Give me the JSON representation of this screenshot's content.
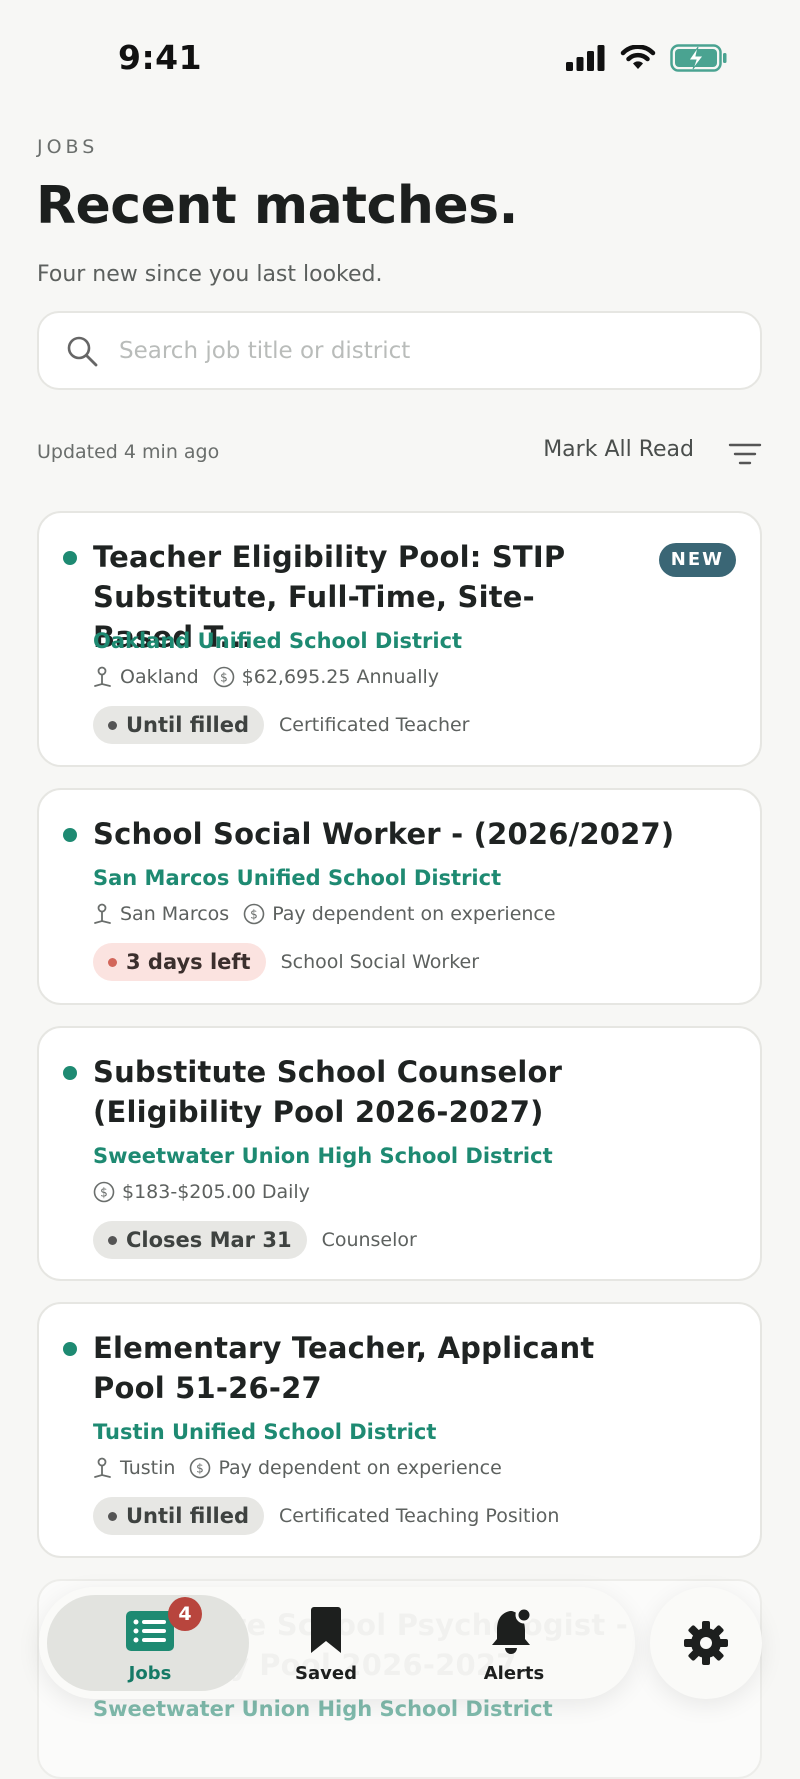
{
  "status": {
    "time": "9:41"
  },
  "header": {
    "eyebrow": "JOBS",
    "title": "Recent matches.",
    "subtitle": "Four new since you last looked."
  },
  "search": {
    "placeholder": "Search job title or district",
    "value": ""
  },
  "meta": {
    "updated": "Updated 4 min ago",
    "mark_all": "Mark All Read"
  },
  "jobs": [
    {
      "title": "Teacher Eligibility Pool: STIP Substitute, Full-Time, Site-Based T...",
      "badge": "NEW",
      "district": "Oakland Unified School District",
      "location": "Oakland",
      "salary": "$62,695.25 Annually",
      "deadline": "Until filled",
      "category": "Certificated Teacher"
    },
    {
      "title": "School Social Worker - (2026/2027)",
      "district": "San Marcos Unified School District",
      "location": "San Marcos",
      "salary": "Pay dependent on experience",
      "deadline": "3 days left",
      "category": "School Social Worker"
    },
    {
      "title": "Substitute School Counselor (Eligibility Pool 2026-2027)",
      "district": "Sweetwater Union High School District",
      "salary": "$183-$205.00 Daily",
      "deadline": "Closes Mar 31",
      "category": "Counselor"
    },
    {
      "title": "Elementary Teacher, Applicant Pool 51-26-27",
      "district": "Tustin Unified School District",
      "location": "Tustin",
      "salary": "Pay dependent on experience",
      "deadline": "Until filled",
      "category": "Certificated Teaching Position"
    },
    {
      "title": "Substitute School Psychologist - Eligibility Pool 2026-2027",
      "district": "Sweetwater Union High School District"
    }
  ],
  "tabs": {
    "jobs": "Jobs",
    "jobs_badge": "4",
    "saved": "Saved",
    "alerts": "Alerts"
  },
  "colors": {
    "accent": "#1e8a72",
    "new_badge": "#3a6675",
    "urgent": "#fbe3e0",
    "tab_badge": "#b8453d"
  }
}
